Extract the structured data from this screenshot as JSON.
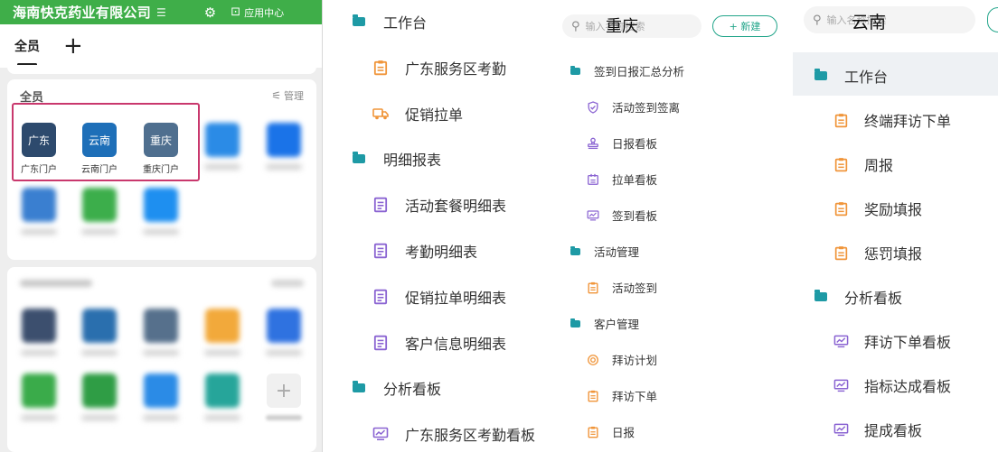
{
  "phone": {
    "header_title": "海南快克药业有限公司",
    "header_menu_glyph": "☰",
    "app_center_label": "应用中心",
    "tab_all": "全员",
    "tab_add": "+",
    "card1_title": "全员",
    "manage_label": "管理",
    "apps": [
      {
        "icon_text": "广东",
        "label": "广东门户"
      },
      {
        "icon_text": "云南",
        "label": "云南门户"
      },
      {
        "icon_text": "重庆",
        "label": "重庆门户"
      }
    ]
  },
  "middle": {
    "search_placeholder": "输入名称搜索",
    "overlay_title": "重庆",
    "new_button": "+ 新建",
    "left_tree": [
      {
        "type": "folder",
        "label": "工作台"
      },
      {
        "type": "item",
        "icon": "clipboard-icon",
        "label": "广东服务区考勤"
      },
      {
        "type": "item",
        "icon": "truck-icon",
        "label": "促销拉单"
      },
      {
        "type": "folder",
        "label": "明细报表"
      },
      {
        "type": "item",
        "icon": "document-icon",
        "label": "活动套餐明细表"
      },
      {
        "type": "item",
        "icon": "document-icon",
        "label": "考勤明细表"
      },
      {
        "type": "item",
        "icon": "document-icon",
        "label": "促销拉单明细表"
      },
      {
        "type": "item",
        "icon": "document-icon",
        "label": "客户信息明细表"
      },
      {
        "type": "folder",
        "label": "分析看板"
      },
      {
        "type": "item",
        "icon": "monitor-chart-icon",
        "label": "广东服务区考勤看板"
      }
    ],
    "right_tree": [
      {
        "type": "folder",
        "label": "签到日报汇总分析"
      },
      {
        "type": "item",
        "icon": "shield-check-icon",
        "label": "活动签到签离"
      },
      {
        "type": "item",
        "icon": "stamp-icon",
        "label": "日报看板"
      },
      {
        "type": "item",
        "icon": "calendar-icon",
        "label": "拉单看板"
      },
      {
        "type": "item",
        "icon": "monitor-chart-icon",
        "label": "签到看板"
      },
      {
        "type": "folder",
        "label": "活动管理"
      },
      {
        "type": "item",
        "icon": "clipboard-icon",
        "label": "活动签到"
      },
      {
        "type": "folder",
        "label": "客户管理"
      },
      {
        "type": "item",
        "icon": "target-icon",
        "label": "拜访计划"
      },
      {
        "type": "item",
        "icon": "clipboard-icon",
        "label": "拜访下单"
      },
      {
        "type": "item",
        "icon": "clipboard-icon",
        "label": "日报"
      }
    ]
  },
  "right": {
    "search_placeholder": "输入名称搜索",
    "overlay_title": "云南",
    "tree": [
      {
        "type": "folder",
        "label": "工作台"
      },
      {
        "type": "item",
        "icon": "clipboard-icon",
        "label": "终端拜访下单"
      },
      {
        "type": "item",
        "icon": "clipboard-icon",
        "label": "周报"
      },
      {
        "type": "item",
        "icon": "clipboard-icon",
        "label": "奖励填报"
      },
      {
        "type": "item",
        "icon": "clipboard-icon",
        "label": "惩罚填报"
      },
      {
        "type": "folder",
        "label": "分析看板"
      },
      {
        "type": "item",
        "icon": "monitor-chart-icon",
        "label": "拜访下单看板"
      },
      {
        "type": "item",
        "icon": "monitor-chart-icon",
        "label": "指标达成看板"
      },
      {
        "type": "item",
        "icon": "monitor-chart-icon",
        "label": "提成看板"
      }
    ]
  },
  "colors": {
    "brand_green": "#3fae49",
    "folder_teal": "#1e9aa5",
    "icon_orange": "#f0953a",
    "icon_purple": "#8a63d2",
    "highlight": "#c9386d",
    "new_button": "#22a58a"
  }
}
